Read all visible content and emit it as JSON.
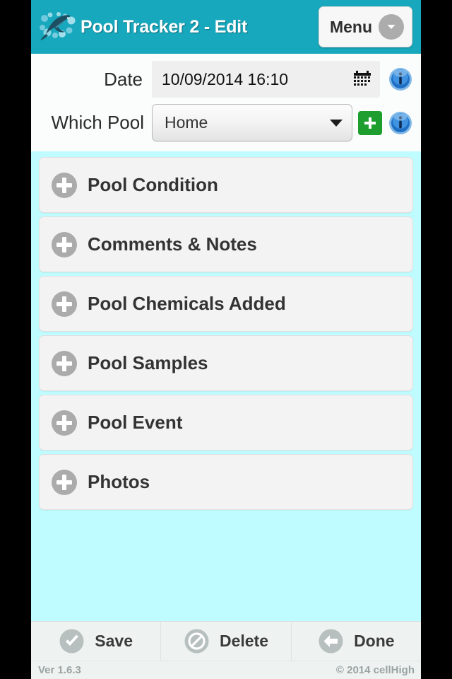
{
  "header": {
    "logo_icon": "dolphin-logo-icon",
    "title": "Pool Tracker 2 - Edit",
    "menu_label": "Menu",
    "menu_icon": "chevron-down-icon",
    "background_color": "#17A8BD"
  },
  "form": {
    "date": {
      "label": "Date",
      "value": "10/09/2014 16:10",
      "calendar_icon": "calendar-icon",
      "info_icon": "info-icon"
    },
    "pool": {
      "label": "Which Pool",
      "value": "Home",
      "caret_icon": "caret-down-icon",
      "add_icon": "plus-icon",
      "add_color": "#1E9E2E",
      "info_icon": "info-icon"
    }
  },
  "sections": [
    {
      "label": "Pool Condition",
      "icon": "plus-circle-icon"
    },
    {
      "label": "Comments & Notes",
      "icon": "plus-circle-icon"
    },
    {
      "label": "Pool Chemicals Added",
      "icon": "plus-circle-icon"
    },
    {
      "label": "Pool Samples",
      "icon": "plus-circle-icon"
    },
    {
      "label": "Pool Event",
      "icon": "plus-circle-icon"
    },
    {
      "label": "Photos",
      "icon": "plus-circle-icon"
    }
  ],
  "toolbar": [
    {
      "label": "Save",
      "icon": "check-circle-icon"
    },
    {
      "label": "Delete",
      "icon": "prohibition-circle-icon"
    },
    {
      "label": "Done",
      "icon": "back-arrow-circle-icon"
    }
  ],
  "footer": {
    "version": "Ver 1.6.3",
    "copyright": "© 2014 cellHigh"
  },
  "colors": {
    "page_background": "#BFFCFF",
    "header_teal": "#17A8BD",
    "form_background": "#FBFCFC",
    "section_fill": "#F3F3F3",
    "toolbar_fill": "#EEF3F2"
  }
}
